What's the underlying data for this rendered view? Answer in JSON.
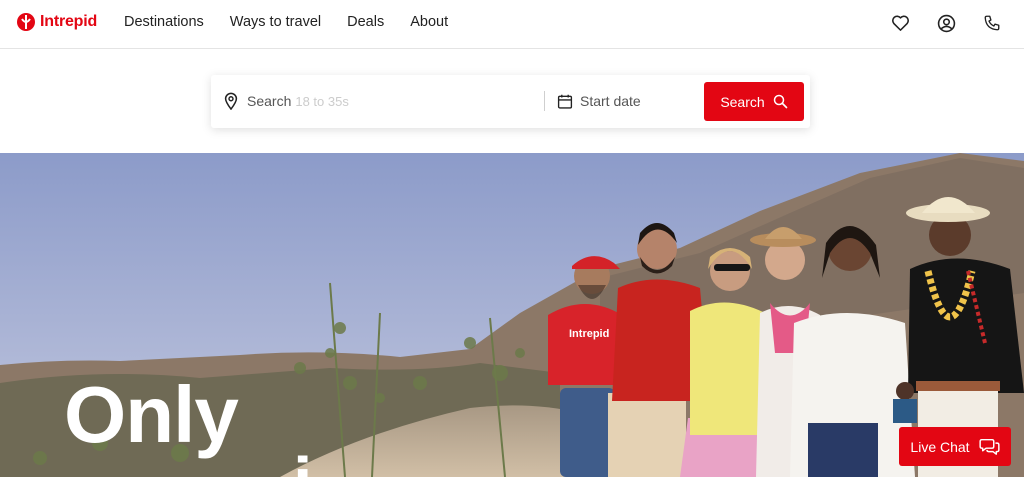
{
  "brand": {
    "name": "Intrepid",
    "color": "#e30613"
  },
  "nav": {
    "items": [
      "Destinations",
      "Ways to travel",
      "Deals",
      "About"
    ]
  },
  "header_icons": [
    "heart-icon",
    "account-icon",
    "phone-icon"
  ],
  "search": {
    "placeholder": "Search",
    "ghost_text": "18 to 35s",
    "date_placeholder": "Start date",
    "button_label": "Search"
  },
  "hero": {
    "title_line1": "Only",
    "title_line2": "i",
    "shirt_logo": "Intrepid"
  },
  "live_chat": {
    "label": "Live Chat"
  }
}
